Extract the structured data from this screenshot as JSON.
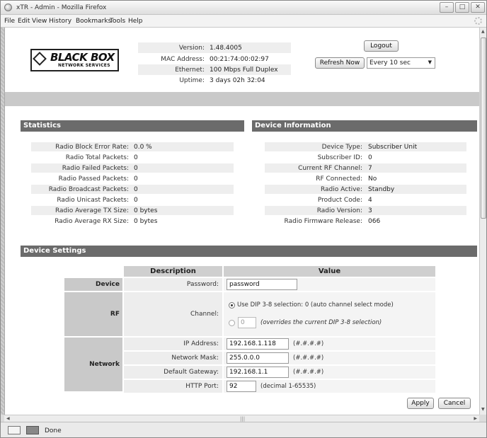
{
  "window": {
    "title": "xTR - Admin - Mozilla Firefox",
    "minimize": "–",
    "maximize": "□",
    "close": "✕"
  },
  "menu": [
    "File",
    "Edit",
    "View",
    "History",
    "Bookmarks",
    "Tools",
    "Help"
  ],
  "logo": {
    "main": "BLACK BOX",
    "sub": "NETWORK SERVICES"
  },
  "device_info_header": [
    {
      "label": "Version:",
      "value": "1.48.4005"
    },
    {
      "label": "MAC Address:",
      "value": "00:21:74:00:02:97"
    },
    {
      "label": "Ethernet:",
      "value": "100 Mbps Full Duplex"
    },
    {
      "label": "Uptime:",
      "value": "3 days 02h 32:04"
    }
  ],
  "logout_label": "Logout",
  "refresh_label": "Refresh Now",
  "refresh_interval": "Every 10 sec",
  "statistics": {
    "title": "Statistics",
    "rows": [
      {
        "label": "Radio Block Error Rate:",
        "value": "0.0 %"
      },
      {
        "label": "Radio Total Packets:",
        "value": "0"
      },
      {
        "label": "Radio Failed Packets:",
        "value": "0"
      },
      {
        "label": "Radio Passed Packets:",
        "value": "0"
      },
      {
        "label": "Radio Broadcast Packets:",
        "value": "0"
      },
      {
        "label": "Radio Unicast Packets:",
        "value": "0"
      },
      {
        "label": "Radio Average TX Size:",
        "value": "0 bytes"
      },
      {
        "label": "Radio Average RX Size:",
        "value": "0 bytes"
      }
    ]
  },
  "device_information": {
    "title": "Device Information",
    "rows": [
      {
        "label": "Device Type:",
        "value": "Subscriber Unit"
      },
      {
        "label": "Subscriber ID:",
        "value": "0"
      },
      {
        "label": "Current RF Channel:",
        "value": "7"
      },
      {
        "label": "RF Connected:",
        "value": "No"
      },
      {
        "label": "Radio Active:",
        "value": "Standby"
      },
      {
        "label": "Product Code:",
        "value": "4"
      },
      {
        "label": "Radio Version:",
        "value": "3"
      },
      {
        "label": "Radio Firmware Release:",
        "value": "066"
      }
    ]
  },
  "device_settings": {
    "title": "Device Settings",
    "col_description": "Description",
    "col_value": "Value",
    "device_group": "Device",
    "password_label": "Password:",
    "password_value": "password",
    "rf_group": "RF",
    "channel_label": "Channel:",
    "channel_option_dip": "Use DIP 3-8 selection: 0 (auto channel select mode)",
    "channel_manual_value": "0",
    "channel_manual_hint": "(overrides the current DIP 3-8 selection)",
    "network_group": "Network",
    "ip_label": "IP Address:",
    "ip_value": "192.168.1.118",
    "ip_hint": "(#.#.#.#)",
    "mask_label": "Network Mask:",
    "mask_value": "255.0.0.0",
    "mask_hint": "(#.#.#.#)",
    "gateway_label": "Default Gateway:",
    "gateway_value": "192.168.1.1",
    "gateway_hint": "(#.#.#.#)",
    "http_label": "HTTP Port:",
    "http_value": "92",
    "http_hint": "(decimal 1-65535)"
  },
  "apply_label": "Apply",
  "cancel_label": "Cancel",
  "status_text": "Done",
  "scroll": {
    "up": "▲",
    "down": "▼",
    "left": "◀",
    "right": "▶",
    "grip": "|||"
  },
  "select_arrow": "▼"
}
